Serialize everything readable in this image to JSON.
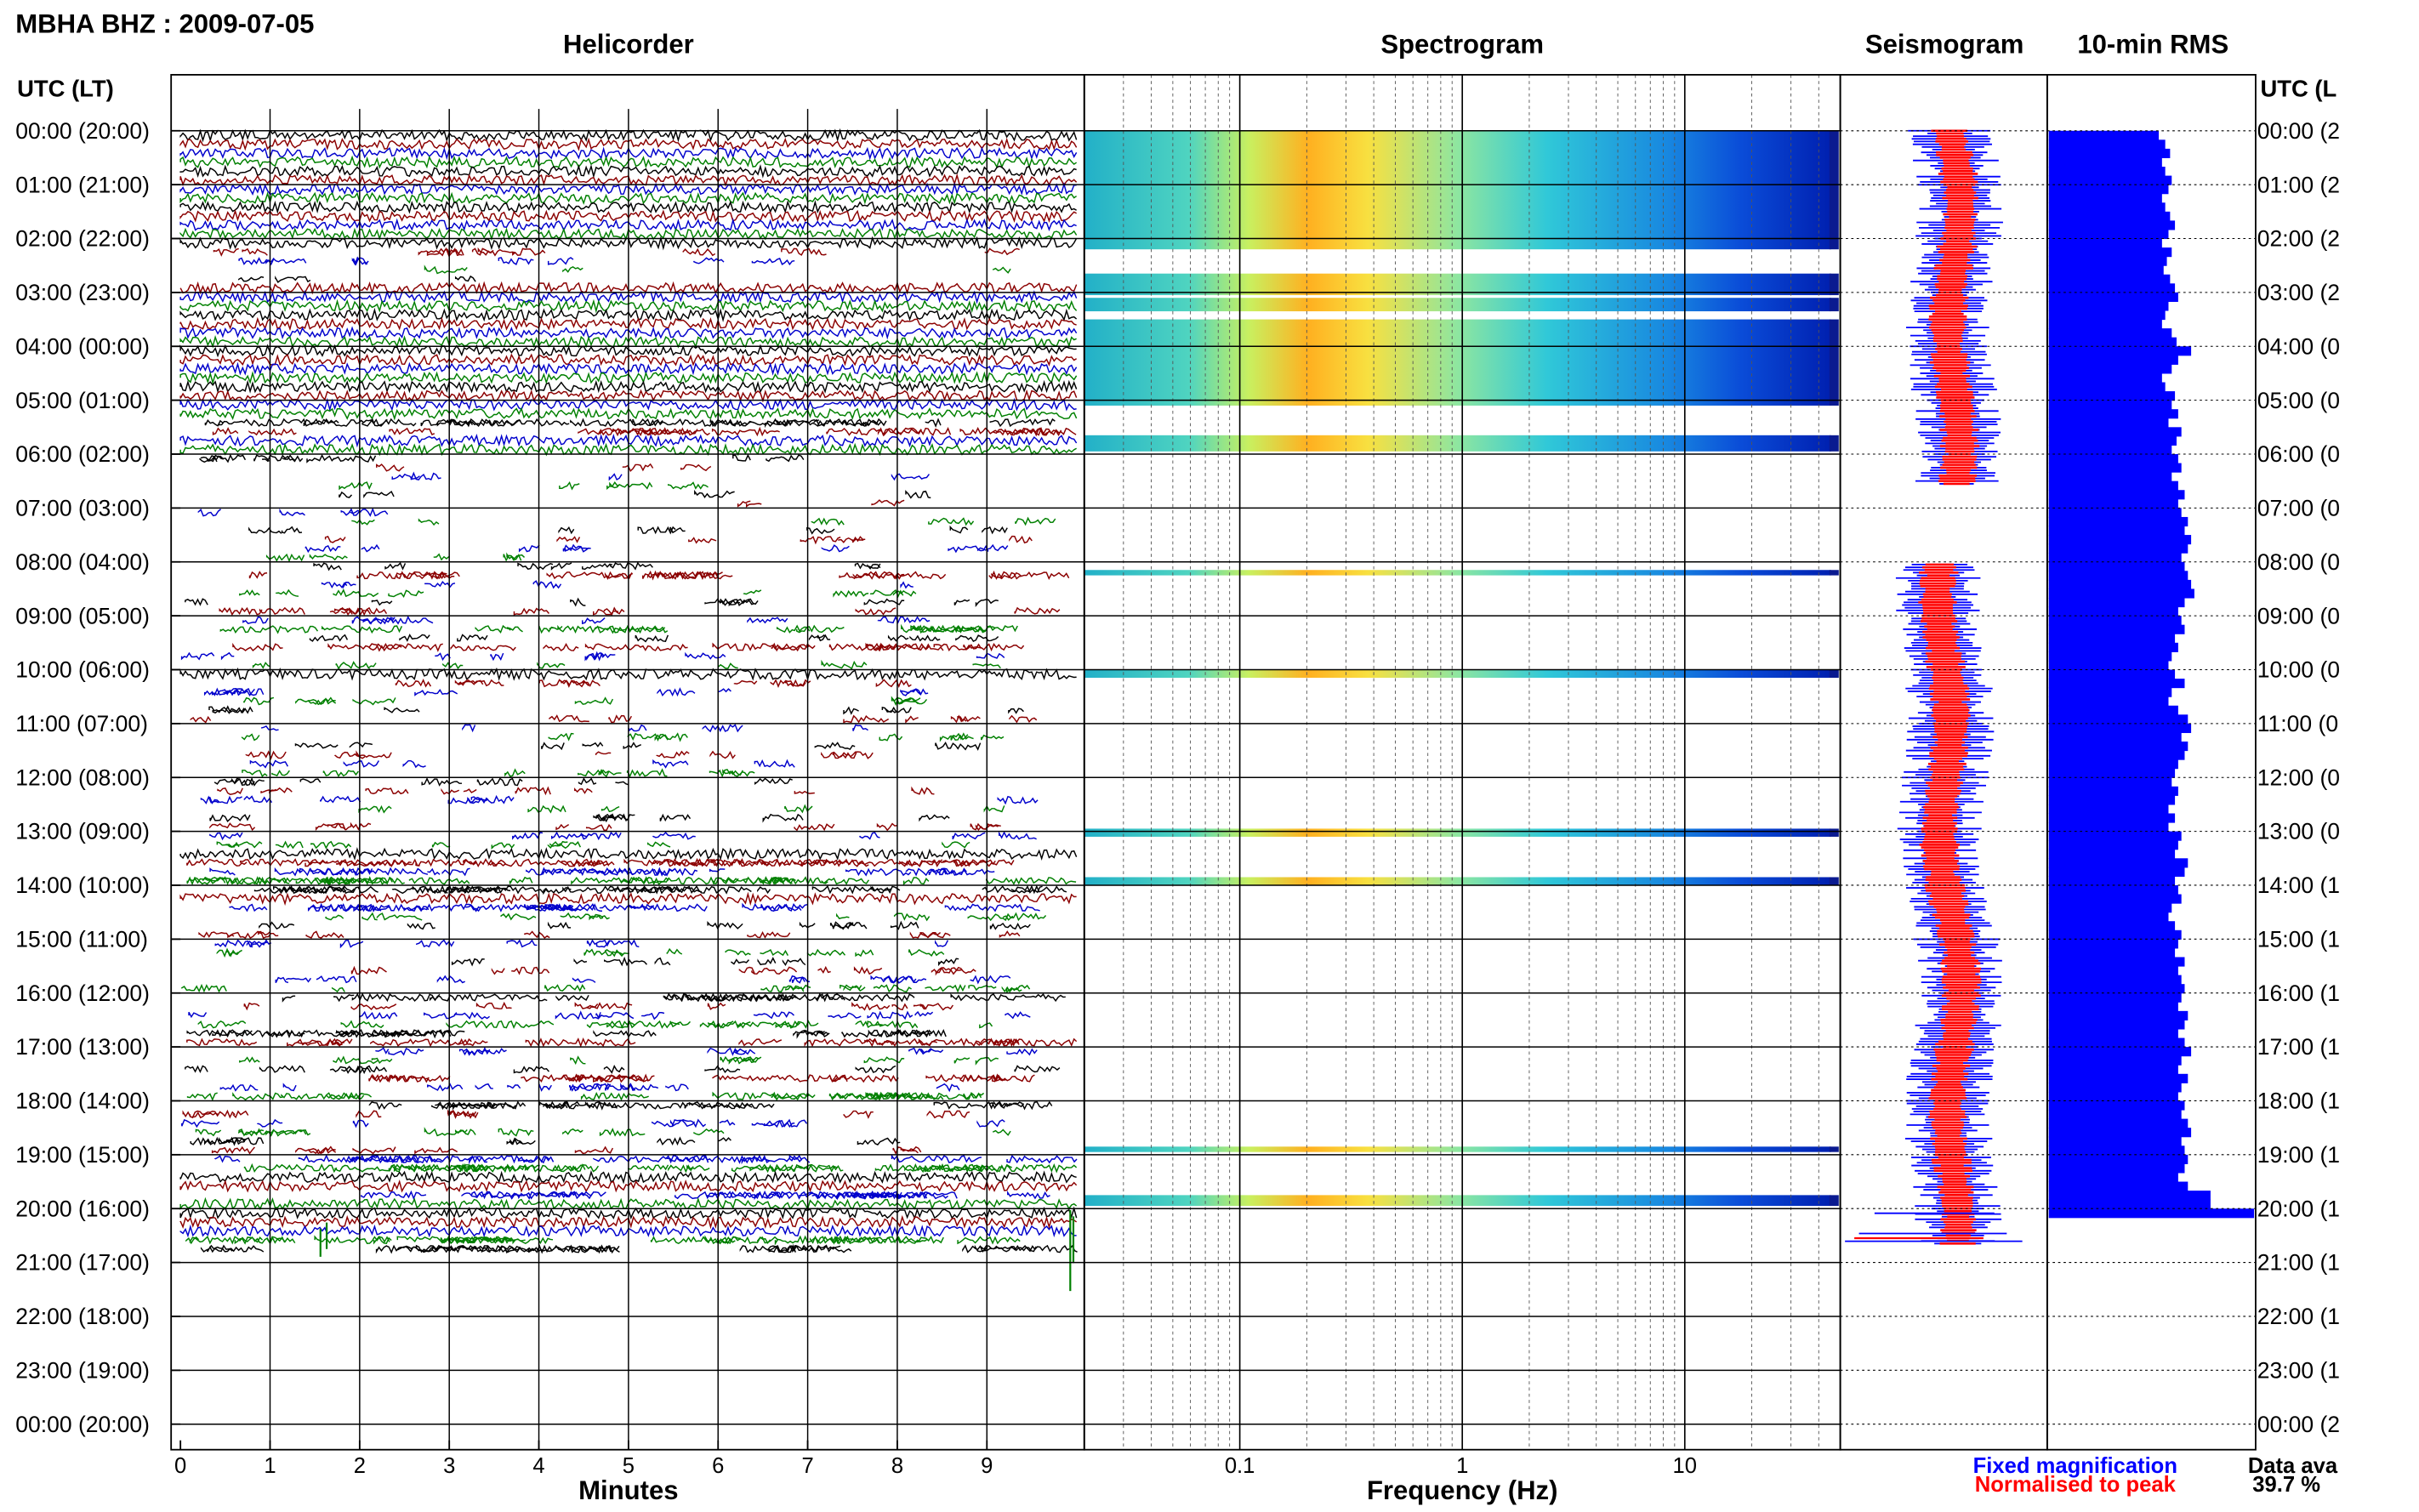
{
  "title": "MBHA BHZ : 2009-07-05",
  "panels": {
    "helicorder": "Helicorder",
    "spectrogram": "Spectrogram",
    "seismogram": "Seismogram",
    "rms": "10-min RMS"
  },
  "axis_labels": {
    "time_left": "UTC (LT)",
    "time_right": "UTC (L",
    "minutes": "Minutes",
    "frequency": "Frequency (Hz)"
  },
  "legend": {
    "fixed": "Fixed magnification",
    "normalised": "Normalised to peak"
  },
  "availability": {
    "label": "Data ava",
    "value": "39.7 %"
  },
  "colors": {
    "trace_black": "#000000",
    "trace_red": "#8b0000",
    "trace_blue": "#0000cc",
    "trace_green": "#008000",
    "rms_bar": "#0000ff",
    "seis_red": "#ff0000",
    "seis_blue": "#0000ff",
    "grid": "#000000"
  },
  "chart_data": [
    {
      "type": "line",
      "panel": "Helicorder",
      "xlabel": "Minutes",
      "xlim": [
        0,
        10
      ],
      "x_ticks": [
        "0",
        "1",
        "2",
        "3",
        "4",
        "5",
        "6",
        "7",
        "8",
        "9"
      ],
      "ylabel": "UTC (LT)",
      "y_ticks_left": [
        "00:00 (20:00)",
        "01:00 (21:00)",
        "02:00 (22:00)",
        "03:00 (23:00)",
        "04:00 (00:00)",
        "05:00 (01:00)",
        "06:00 (02:00)",
        "07:00 (03:00)",
        "08:00 (04:00)",
        "09:00 (05:00)",
        "10:00 (06:00)",
        "11:00 (07:00)",
        "12:00 (08:00)",
        "13:00 (09:00)",
        "14:00 (10:00)",
        "15:00 (11:00)",
        "16:00 (12:00)",
        "17:00 (13:00)",
        "18:00 (14:00)",
        "19:00 (15:00)",
        "20:00 (16:00)",
        "21:00 (17:00)",
        "22:00 (18:00)",
        "23:00 (19:00)",
        "00:00 (20:00)"
      ],
      "y_ticks_right": [
        "00:00 (2",
        "01:00 (2",
        "02:00 (2",
        "03:00 (2",
        "04:00 (0",
        "05:00 (0",
        "06:00 (0",
        "07:00 (0",
        "08:00 (0",
        "09:00 (0",
        "10:00 (0",
        "11:00 (0",
        "12:00 (0",
        "13:00 (0",
        "14:00 (1",
        "15:00 (1",
        "16:00 (1",
        "17:00 (1",
        "18:00 (1",
        "19:00 (1",
        "20:00 (1",
        "21:00 (1",
        "22:00 (1",
        "23:00 (1",
        "00:00 (2"
      ],
      "trace_rows_per_hour": 6,
      "row_data_coverage": [
        1,
        1,
        1,
        1,
        1,
        1,
        1,
        1,
        1,
        1,
        1,
        1,
        1,
        0.4,
        0.3,
        0.1,
        0.1,
        1,
        1,
        1,
        1,
        1,
        1,
        1,
        1,
        1,
        1,
        1,
        1,
        1,
        1,
        1,
        0.6,
        0.5,
        1,
        1,
        0.4,
        0.1,
        0.15,
        0.2,
        0.15,
        0.1,
        0.15,
        0.2,
        0.3,
        0.25,
        0.3,
        0.2,
        0.3,
        0.5,
        0.2,
        0.3,
        0.35,
        0.4,
        0.3,
        0.5,
        0.35,
        0.5,
        0.3,
        0.25,
        1,
        0.4,
        0.3,
        0.3,
        0.25,
        0.3,
        0.2,
        0.3,
        0.25,
        0.3,
        0.2,
        0.35,
        0.3,
        0.4,
        0.3,
        0.2,
        0.25,
        0.4,
        0.3,
        0.4,
        1,
        0.8,
        0.6,
        0.7,
        0.6,
        1,
        0.6,
        0.4,
        0.4,
        0.35,
        0.35,
        0.4,
        0.3,
        0.35,
        0.4,
        0.45,
        0.5,
        0.4,
        0.45,
        0.5,
        0.6,
        0.5,
        0.4,
        0.4,
        0.35,
        0.5,
        0.45,
        0.5,
        0.5,
        0.3,
        0.35,
        0.45,
        0.35,
        0.3,
        0.5,
        0.8,
        0.9,
        0.9,
        0.7,
        0.9,
        0.9,
        0.95,
        0.9,
        0.8,
        0.7,
        0,
        0,
        0,
        0,
        0,
        0,
        0,
        0,
        0,
        0,
        0,
        0,
        0,
        0,
        0,
        0,
        0,
        0,
        0
      ]
    },
    {
      "type": "heatmap",
      "panel": "Spectrogram",
      "xlabel": "Frequency (Hz)",
      "x_scale": "log",
      "xlim": [
        0.02,
        50
      ],
      "x_ticks": [
        "0.1",
        "1",
        "10"
      ],
      "colormap": "jet",
      "data_hours": [
        [
          0.0,
          2.2
        ],
        [
          2.65,
          3.05
        ],
        [
          3.1,
          3.35
        ],
        [
          3.5,
          5.1
        ],
        [
          5.65,
          5.95
        ],
        [
          8.15,
          8.25
        ],
        [
          10.0,
          10.15
        ],
        [
          12.95,
          13.1
        ],
        [
          13.85,
          14.0
        ],
        [
          18.85,
          18.95
        ],
        [
          19.75,
          19.95
        ]
      ]
    },
    {
      "type": "line",
      "panel": "Seismogram",
      "series": [
        {
          "name": "Fixed magnification"
        },
        {
          "name": "Normalised to peak"
        }
      ]
    },
    {
      "type": "bar",
      "panel": "10-min RMS",
      "orientation": "horizontal",
      "values_relative": [
        0.68,
        0.72,
        0.75,
        0.7,
        0.72,
        0.76,
        0.74,
        0.7,
        0.72,
        0.75,
        0.78,
        0.74,
        0.7,
        0.76,
        0.73,
        0.71,
        0.75,
        0.78,
        0.8,
        0.74,
        0.72,
        0.7,
        0.76,
        0.79,
        0.88,
        0.8,
        0.76,
        0.7,
        0.72,
        0.78,
        0.76,
        0.8,
        0.74,
        0.82,
        0.79,
        0.76,
        0.8,
        0.82,
        0.76,
        0.8,
        0.84,
        0.8,
        0.82,
        0.86,
        0.84,
        0.88,
        0.86,
        0.82,
        0.84,
        0.86,
        0.88,
        0.9,
        0.84,
        0.8,
        0.82,
        0.84,
        0.78,
        0.8,
        0.76,
        0.74,
        0.78,
        0.84,
        0.76,
        0.74,
        0.8,
        0.86,
        0.88,
        0.82,
        0.86,
        0.84,
        0.8,
        0.78,
        0.76,
        0.8,
        0.78,
        0.74,
        0.78,
        0.74,
        0.82,
        0.8,
        0.78,
        0.86,
        0.84,
        0.78,
        0.8,
        0.82,
        0.76,
        0.74,
        0.78,
        0.82,
        0.8,
        0.78,
        0.84,
        0.8,
        0.82,
        0.84,
        0.82,
        0.8,
        0.86,
        0.84,
        0.8,
        0.84,
        0.88,
        0.82,
        0.8,
        0.86,
        0.82,
        0.8,
        0.84,
        0.82,
        0.86,
        0.88,
        0.82,
        0.84,
        0.86,
        0.84,
        0.8,
        0.86,
        1.0,
        1.0,
        1.0,
        0.0,
        0.0,
        0.0
      ]
    }
  ]
}
